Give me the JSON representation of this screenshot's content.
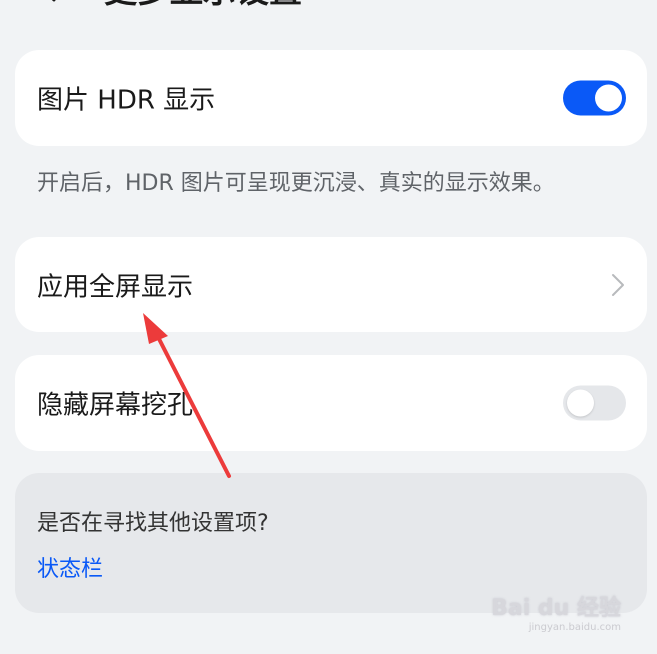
{
  "header": {
    "title": "更多显示设置"
  },
  "hdr_setting": {
    "label": "图片 HDR 显示",
    "enabled": true,
    "description": "开启后，HDR 图片可呈现更沉浸、真实的显示效果。"
  },
  "fullscreen_setting": {
    "label": "应用全屏显示"
  },
  "notch_setting": {
    "label": "隐藏屏幕挖孔",
    "enabled": false
  },
  "search_suggestion": {
    "question": "是否在寻找其他设置项?",
    "link_label": "状态栏"
  },
  "watermark": {
    "logo": "Bai du 经验",
    "url": "jingyan.baidu.com"
  },
  "colors": {
    "accent": "#0a59f7",
    "background": "#f1f3f5",
    "annotation_arrow": "#ec3b3b"
  },
  "icons": {
    "back": "back-arrow-icon",
    "chevron": "chevron-right-icon",
    "annotation": "red-arrow-icon"
  }
}
